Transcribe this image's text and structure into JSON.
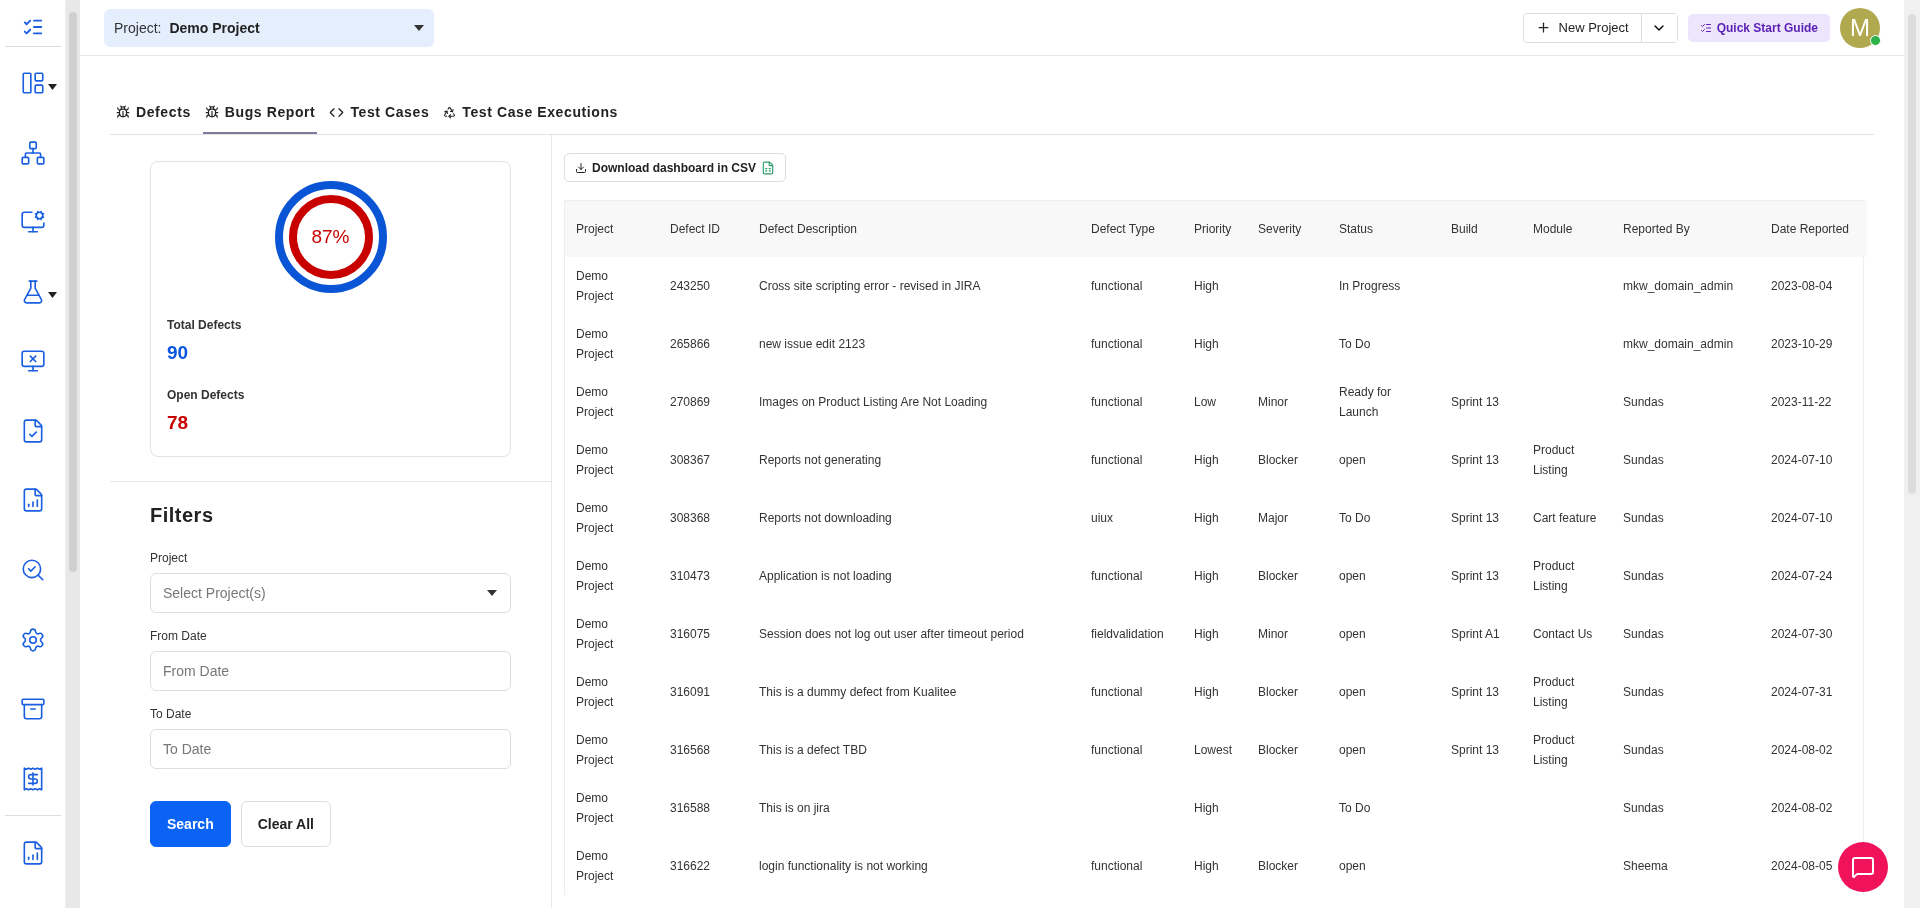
{
  "header": {
    "project_label": "Project:",
    "project_value": "Demo Project",
    "new_project": "New Project",
    "quick_start": "Quick Start Guide",
    "avatar_initial": "M",
    "online": true
  },
  "tabs": [
    {
      "label": "Defects",
      "kind": "bug",
      "selected": false
    },
    {
      "label": "Bugs Report",
      "kind": "bug",
      "selected": true
    },
    {
      "label": "Test Cases",
      "kind": "code",
      "selected": false
    },
    {
      "label": "Test Case Executions",
      "kind": "recycle",
      "selected": false
    }
  ],
  "summary": {
    "percent": "87%",
    "total_label": "Total Defects",
    "total_value": "90",
    "open_label": "Open Defects",
    "open_value": "78"
  },
  "filters": {
    "title": "Filters",
    "fields": [
      {
        "label": "Project",
        "kind": "select",
        "placeholder": "Select Project(s)"
      },
      {
        "label": "From Date",
        "kind": "input",
        "placeholder": "From Date"
      },
      {
        "label": "To Date",
        "kind": "input",
        "placeholder": "To Date"
      }
    ],
    "buttons": [
      {
        "label": "Search",
        "kind": "primary"
      },
      {
        "label": "Clear All",
        "kind": "secondary"
      }
    ]
  },
  "download_button": "Download dashboard in CSV",
  "table": {
    "columns": [
      "Project",
      "Defect ID",
      "Defect Description",
      "Defect Type",
      "Priority",
      "Severity",
      "Status",
      "Build",
      "Module",
      "Reported By",
      "Date Reported"
    ],
    "rows": [
      [
        "Demo Project",
        "243250",
        "Cross site scripting error - revised in JIRA",
        "functional",
        "High",
        "",
        "In Progress",
        "",
        "",
        "mkw_domain_admin",
        "2023-08-04"
      ],
      [
        "Demo Project",
        "265866",
        "new issue edit 2123",
        "functional",
        "High",
        "",
        "To Do",
        "",
        "",
        "mkw_domain_admin",
        "2023-10-29"
      ],
      [
        "Demo Project",
        "270869",
        "Images on Product Listing Are Not Loading",
        "functional",
        "Low",
        "Minor",
        "Ready for Launch",
        "Sprint 13",
        "",
        "Sundas",
        "2023-11-22"
      ],
      [
        "Demo Project",
        "308367",
        "Reports not generating",
        "functional",
        "High",
        "Blocker",
        "open",
        "Sprint 13",
        "Product Listing",
        "Sundas",
        "2024-07-10"
      ],
      [
        "Demo Project",
        "308368",
        "Reports not downloading",
        "uiux",
        "High",
        "Major",
        "To Do",
        "Sprint 13",
        "Cart feature",
        "Sundas",
        "2024-07-10"
      ],
      [
        "Demo Project",
        "310473",
        "Application is not loading",
        "functional",
        "High",
        "Blocker",
        "open",
        "Sprint 13",
        "Product Listing",
        "Sundas",
        "2024-07-24"
      ],
      [
        "Demo Project",
        "316075",
        "Session does not log out user after timeout period",
        "fieldvalidation",
        "High",
        "Minor",
        "open",
        "Sprint A1",
        "Contact Us",
        "Sundas",
        "2024-07-30"
      ],
      [
        "Demo Project",
        "316091",
        "This is a dummy defect from Kualitee",
        "functional",
        "High",
        "Blocker",
        "open",
        "Sprint 13",
        "Product Listing",
        "Sundas",
        "2024-07-31"
      ],
      [
        "Demo Project",
        "316568",
        "This is a defect TBD",
        "functional",
        "Lowest",
        "Blocker",
        "open",
        "Sprint 13",
        "Product Listing",
        "Sundas",
        "2024-08-02"
      ],
      [
        "Demo Project",
        "316588",
        "This is on jira",
        "",
        "High",
        "",
        "To Do",
        "",
        "",
        "Sundas",
        "2024-08-02"
      ],
      [
        "Demo Project",
        "316622",
        "login functionality is not working",
        "functional",
        "High",
        "Blocker",
        "open",
        "",
        "",
        "Sheema",
        "2024-08-05"
      ]
    ]
  }
}
